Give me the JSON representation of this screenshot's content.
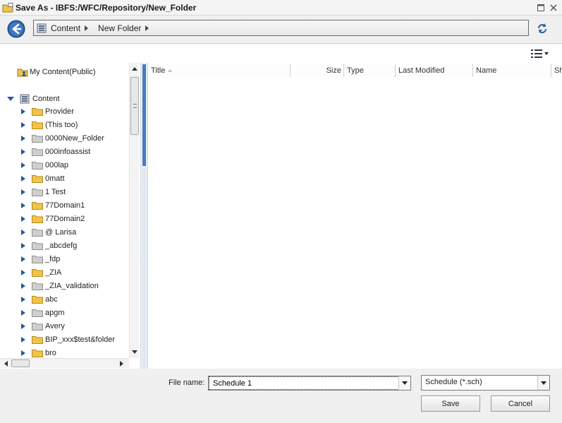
{
  "window": {
    "title": "Save As - IBFS:/WFC/Repository/New_Folder"
  },
  "breadcrumb": [
    {
      "label": "Content"
    },
    {
      "label": "New Folder"
    }
  ],
  "tree": {
    "root_items": [
      {
        "label": "My Content(Public)",
        "icon": "user-folder-icon"
      }
    ],
    "content_label": "Content",
    "folders": [
      {
        "label": "Provider",
        "color": "yellow"
      },
      {
        "label": "(This too)",
        "color": "yellow"
      },
      {
        "label": "0000New_Folder",
        "color": "gray"
      },
      {
        "label": "000infoassist",
        "color": "gray"
      },
      {
        "label": "000lap",
        "color": "gray"
      },
      {
        "label": "0matt",
        "color": "yellow"
      },
      {
        "label": "1 Test",
        "color": "gray"
      },
      {
        "label": "77Domain1",
        "color": "yellow"
      },
      {
        "label": "77Domain2",
        "color": "yellow"
      },
      {
        "label": "@ Larisa",
        "color": "gray"
      },
      {
        "label": "_abcdefg",
        "color": "gray"
      },
      {
        "label": "_fdp",
        "color": "gray"
      },
      {
        "label": "_ZIA",
        "color": "yellow"
      },
      {
        "label": "_ZIA_validation",
        "color": "gray"
      },
      {
        "label": "abc",
        "color": "yellow"
      },
      {
        "label": "apgm",
        "color": "gray"
      },
      {
        "label": "Avery",
        "color": "gray"
      },
      {
        "label": "BIP_xxx$test&folder",
        "color": "yellow"
      },
      {
        "label": "bro",
        "color": "yellow"
      }
    ]
  },
  "list": {
    "columns": [
      {
        "label": "Title"
      },
      {
        "label": "Size"
      },
      {
        "label": "Type"
      },
      {
        "label": "Last Modified"
      },
      {
        "label": "Name"
      },
      {
        "label": "Sh"
      }
    ]
  },
  "footer": {
    "file_name_label": "File name:",
    "file_name_value": "Schedule 1",
    "file_type_value": "Schedule (*.sch)",
    "save_label": "Save",
    "cancel_label": "Cancel"
  },
  "colors": {
    "accent": "#1f5a9a",
    "folder_yellow": "#f2c34a",
    "folder_gray": "#c8c8c8",
    "splitter_blue": "#4a7bc2"
  }
}
